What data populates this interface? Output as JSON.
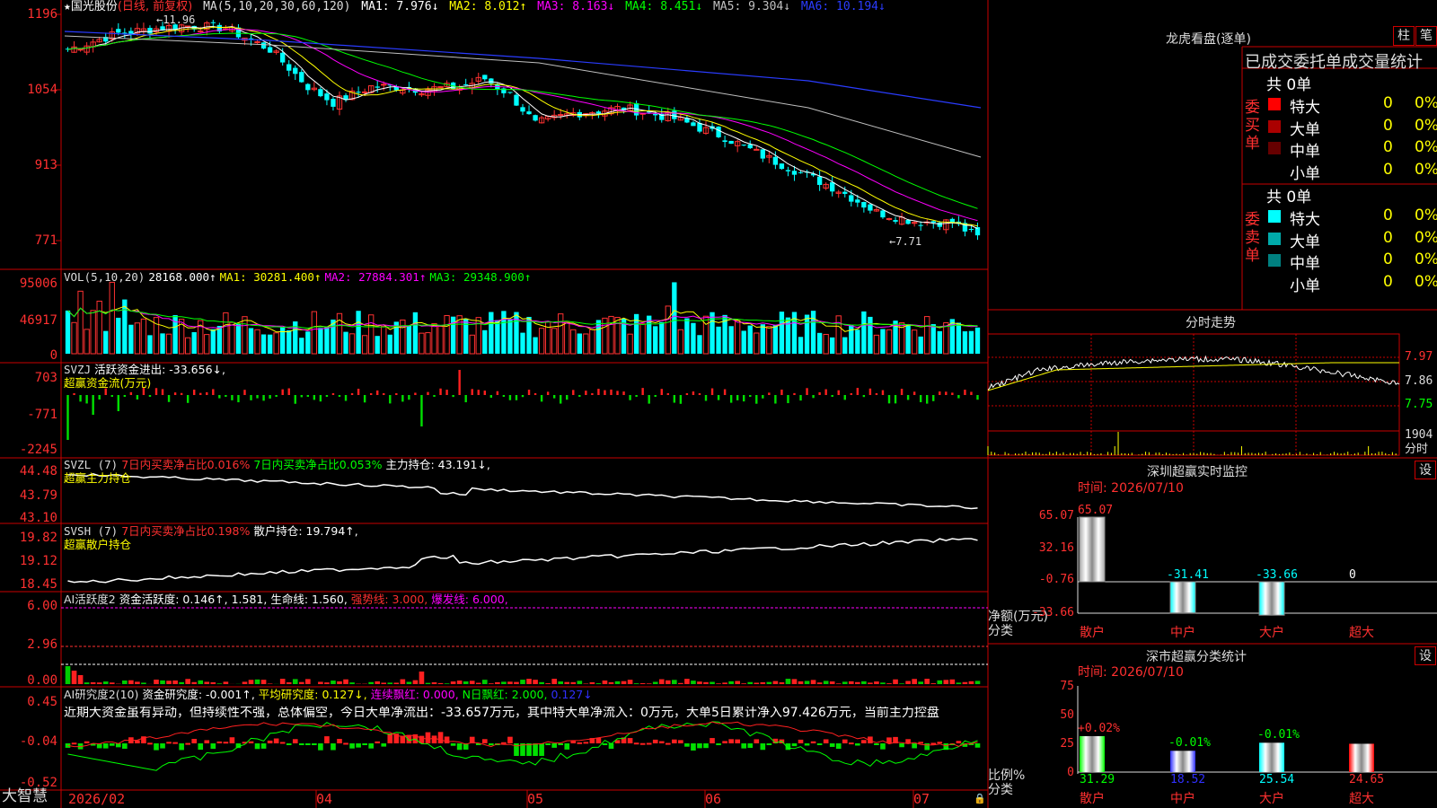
{
  "stock": {
    "star": "★",
    "name": "国光股份",
    "period": "(日线, 前复权)"
  },
  "ma_line": {
    "label": "MA(5,10,20,30,60,120)",
    "ma1": "MA1: 7.976↓",
    "ma2": "MA2: 8.012↑",
    "ma3": "MA3: 8.163↓",
    "ma4": "MA4: 8.451↓",
    "ma5": "MA5: 9.304↓",
    "ma6": "MA6: 10.194↓"
  },
  "price_axis": [
    "1196",
    "1054",
    "913",
    "771"
  ],
  "price_annot": {
    "high": "11.96",
    "low": "7.71"
  },
  "vol": {
    "label": "VOL(5,10,20)",
    "val": "28168.000↑",
    "ma1": "MA1: 30281.400↑",
    "ma2": "MA2: 27884.301↑",
    "ma3": "MA3: 29348.900↑",
    "ticks": [
      "95006",
      "46917",
      "0"
    ]
  },
  "svzj": {
    "label": "SVZJ",
    "t1": "活跃资金进出: -33.656↓,",
    "t2": "超赢资金流(万元)",
    "ticks": [
      "703",
      "-771",
      "-2245"
    ]
  },
  "svzl": {
    "label": "SVZL (7)",
    "t1": "7日内买卖净占比0.016%",
    "t2": "7日内买卖净占比0.053%",
    "t3": "主力持仓: 43.191↓,",
    "t4": "超赢主力持仓",
    "ticks": [
      "44.48",
      "43.79",
      "43.10"
    ]
  },
  "svsh": {
    "label": "SVSH (7)",
    "t1": "7日内买卖净占比0.198%",
    "t2": "散户持仓: 19.794↑,",
    "t3": "超赢散户持仓",
    "ticks": [
      "19.82",
      "19.12",
      "18.45"
    ]
  },
  "ai1": {
    "label": "AI活跃度2",
    "t1": "资金活跃度: 0.146↑, 1.581,",
    "t2": "生命线: 1.560,",
    "t3": "强势线: 3.000,",
    "t4": "爆发线: 6.000,",
    "ticks": [
      "6.00",
      "2.96",
      "0.00"
    ]
  },
  "ai2": {
    "label": "AI研究度2(10)",
    "t1": "资金研究度: -0.001↑,",
    "t2": "平均研究度: 0.127↓,",
    "t3": "连续飘红: 0.000,",
    "t4": "N日飘红: 2.000,",
    "t5": "0.127↓",
    "ticks": [
      "0.45",
      "-0.04",
      "-0.52"
    ]
  },
  "commentary": "近期大资金虽有异动，但持续性不强，总体偏空，今日大单净流出：-33.657万元，其中特大单净流入：0万元，大单5日累计净入97.426万元，当前主力控盘",
  "x_axis": [
    "2026/02",
    "04",
    "05",
    "06",
    "07"
  ],
  "brand": "大智慧",
  "dragon": {
    "title": "龙虎看盘(逐单)",
    "btn_col": "柱",
    "btn_pen": "笔",
    "tabs": "已成交委托单成交量统计",
    "buy_label": "委买单",
    "sell_label": "委卖单",
    "buy_total": "共 0单",
    "sell_total": "共 0单",
    "buy_rows": [
      {
        "name": "特大",
        "count": "0",
        "pct": "0%",
        "color": "#ff0000"
      },
      {
        "name": "大单",
        "count": "0",
        "pct": "0%",
        "color": "#aa0000"
      },
      {
        "name": "中单",
        "count": "0",
        "pct": "0%",
        "color": "#660000"
      },
      {
        "name": "小单",
        "count": "0",
        "pct": "0%",
        "color": ""
      }
    ],
    "sell_rows": [
      {
        "name": "特大",
        "count": "0",
        "pct": "0%",
        "color": "#00ffff"
      },
      {
        "name": "大单",
        "count": "0",
        "pct": "0%",
        "color": "#00aaaa"
      },
      {
        "name": "中单",
        "count": "0",
        "pct": "0%",
        "color": "#008080"
      },
      {
        "name": "小单",
        "count": "0",
        "pct": "0%",
        "color": ""
      }
    ]
  },
  "intraday": {
    "title": "分时走势",
    "ticks": [
      "7.97",
      "7.86",
      "7.75"
    ],
    "vol_tick": "1904",
    "vol_label": "分时"
  },
  "monitor": {
    "title": "深圳超赢实时监控",
    "btn": "设",
    "time": "时间: 2026/07/10",
    "yticks": [
      "65.07",
      "32.16",
      "-0.76",
      "-33.66"
    ],
    "ylabel": "净额(万元)",
    "xlabel": "分类",
    "bars": [
      {
        "cat": "散户",
        "value": 65.07,
        "label": "65.07"
      },
      {
        "cat": "中户",
        "value": -31.41,
        "label": "-31.41"
      },
      {
        "cat": "大户",
        "value": -33.66,
        "label": "-33.66"
      },
      {
        "cat": "超大",
        "value": 0,
        "label": "0"
      }
    ]
  },
  "category": {
    "title": "深市超赢分类统计",
    "btn": "设",
    "time": "时间: 2026/07/10",
    "yticks": [
      "75",
      "50",
      "25",
      "0"
    ],
    "ylabel": "比例%",
    "xlabel": "分类",
    "bars": [
      {
        "cat": "散户",
        "value": 31.29,
        "label": "31.29",
        "change": "+0.02%",
        "color": "#00ff00"
      },
      {
        "cat": "中户",
        "value": 18.52,
        "label": "18.52",
        "change": "-0.01%",
        "color": "#3030ff"
      },
      {
        "cat": "大户",
        "value": 25.54,
        "label": "25.54",
        "change": "-0.01%",
        "color": "#00ffff"
      },
      {
        "cat": "超大",
        "value": 24.65,
        "label": "24.65",
        "change": "",
        "color": "#ff0000"
      }
    ]
  }
}
